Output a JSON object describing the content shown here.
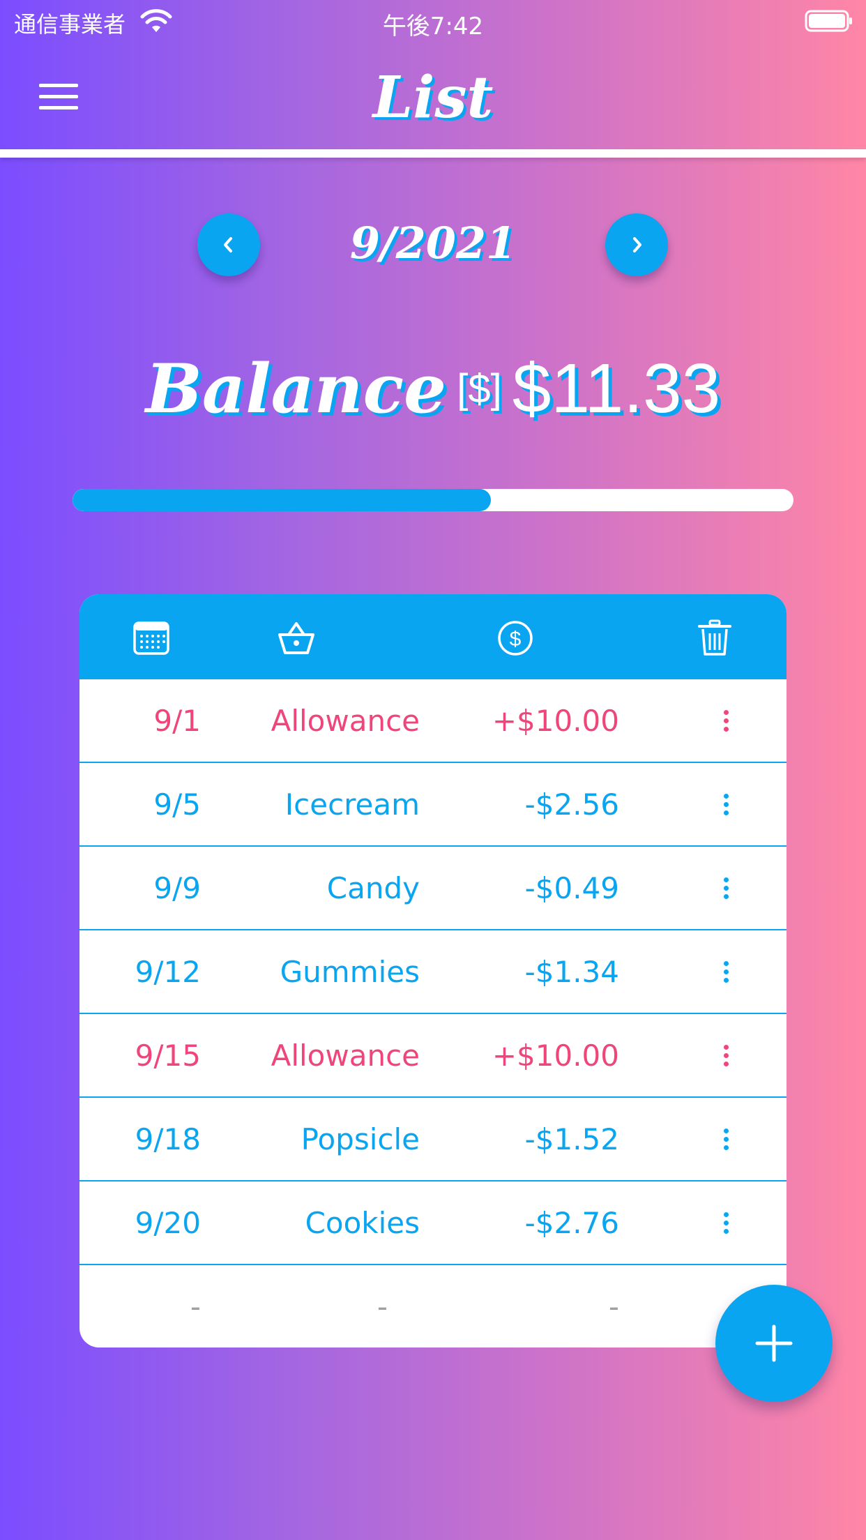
{
  "status_bar": {
    "carrier": "通信事業者",
    "time": "午後7:42"
  },
  "header": {
    "title": "List"
  },
  "month_nav": {
    "label": "9/2021"
  },
  "balance": {
    "word": "Balance",
    "currency": "[$]",
    "amount": "$11.33",
    "progress_percent": 58
  },
  "colors": {
    "accent": "#0aa5f0",
    "income": "#f0457a",
    "expense": "#0aa5f0",
    "placeholder": "#a0a0a0"
  },
  "table": {
    "header_icons": [
      "calendar-icon",
      "basket-icon",
      "dollar-icon",
      "trash-icon"
    ],
    "rows": [
      {
        "date": "9/1",
        "item": "Allowance",
        "amount": "+$10.00",
        "type": "income"
      },
      {
        "date": "9/5",
        "item": "Icecream",
        "amount": "-$2.56",
        "type": "expense"
      },
      {
        "date": "9/9",
        "item": "Candy",
        "amount": "-$0.49",
        "type": "expense"
      },
      {
        "date": "9/12",
        "item": "Gummies",
        "amount": "-$1.34",
        "type": "expense"
      },
      {
        "date": "9/15",
        "item": "Allowance",
        "amount": "+$10.00",
        "type": "income"
      },
      {
        "date": "9/18",
        "item": "Popsicle",
        "amount": "-$1.52",
        "type": "expense"
      },
      {
        "date": "9/20",
        "item": "Cookies",
        "amount": "-$2.76",
        "type": "expense"
      }
    ],
    "empty_row": {
      "date": "-",
      "item": "-",
      "amount": "-"
    }
  }
}
